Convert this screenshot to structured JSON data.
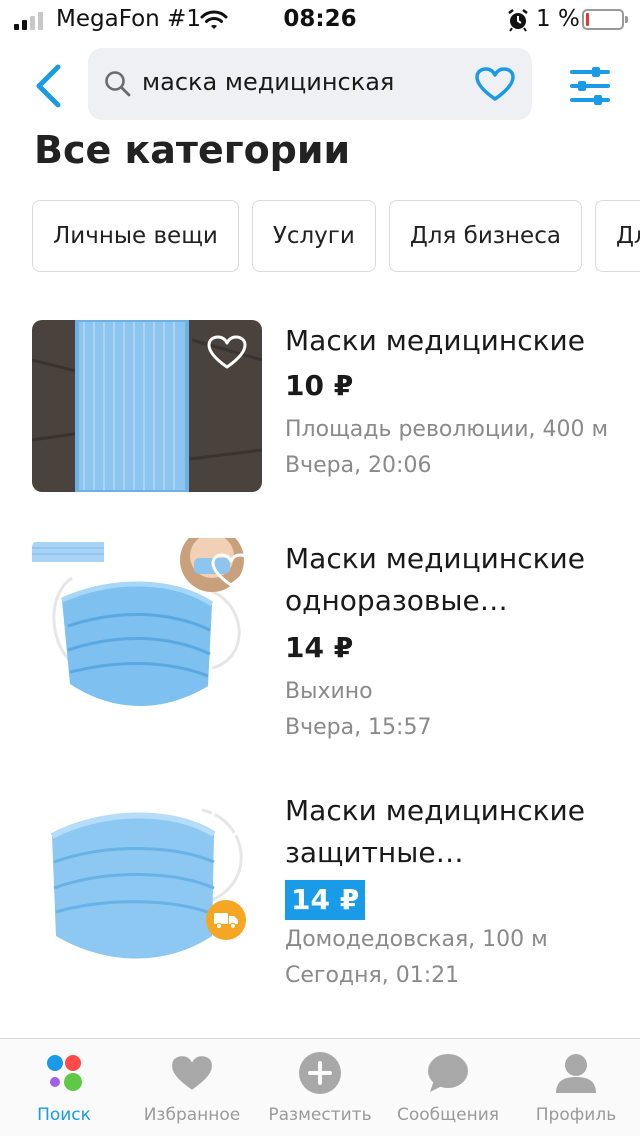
{
  "status_bar": {
    "carrier": "MegaFon #1",
    "time": "08:26",
    "battery": "1 %",
    "battery_level": 0.01
  },
  "search": {
    "query": "маска медицинская"
  },
  "page_title": "Все категории",
  "categories": [
    "Личные вещи",
    "Услуги",
    "Для бизнеса",
    "Для дома и дачи"
  ],
  "listings": [
    {
      "title": "Маски медицинские",
      "price": "10 ₽",
      "location": "Площадь революции, 400 м",
      "time": "Вчера, 20:06",
      "highlighted": false,
      "delivery": false
    },
    {
      "title": "Маски медицинские одноразовые фабричные",
      "price": "14 ₽",
      "location": "Выхино",
      "time": "Вчера, 15:57",
      "highlighted": false,
      "delivery": false
    },
    {
      "title": "Маски медицинские защитные трехслойные",
      "price": "14 ₽",
      "location": "Домодедовская, 100 м",
      "time": "Сегодня, 01:21",
      "highlighted": true,
      "delivery": true
    }
  ],
  "tabbar": {
    "items": [
      {
        "label": "Поиск",
        "icon": "search-dots-icon",
        "active": true
      },
      {
        "label": "Избранное",
        "icon": "heart-icon",
        "active": false
      },
      {
        "label": "Разместить",
        "icon": "plus-circle-icon",
        "active": false
      },
      {
        "label": "Сообщения",
        "icon": "chat-bubble-icon",
        "active": false
      },
      {
        "label": "Профиль",
        "icon": "person-icon",
        "active": false
      }
    ]
  },
  "colors": {
    "accent": "#1a9be8",
    "highlight_price_bg": "#1a9be8",
    "delivery_badge": "#f5a623",
    "secondary_text": "#8a8a8a"
  }
}
